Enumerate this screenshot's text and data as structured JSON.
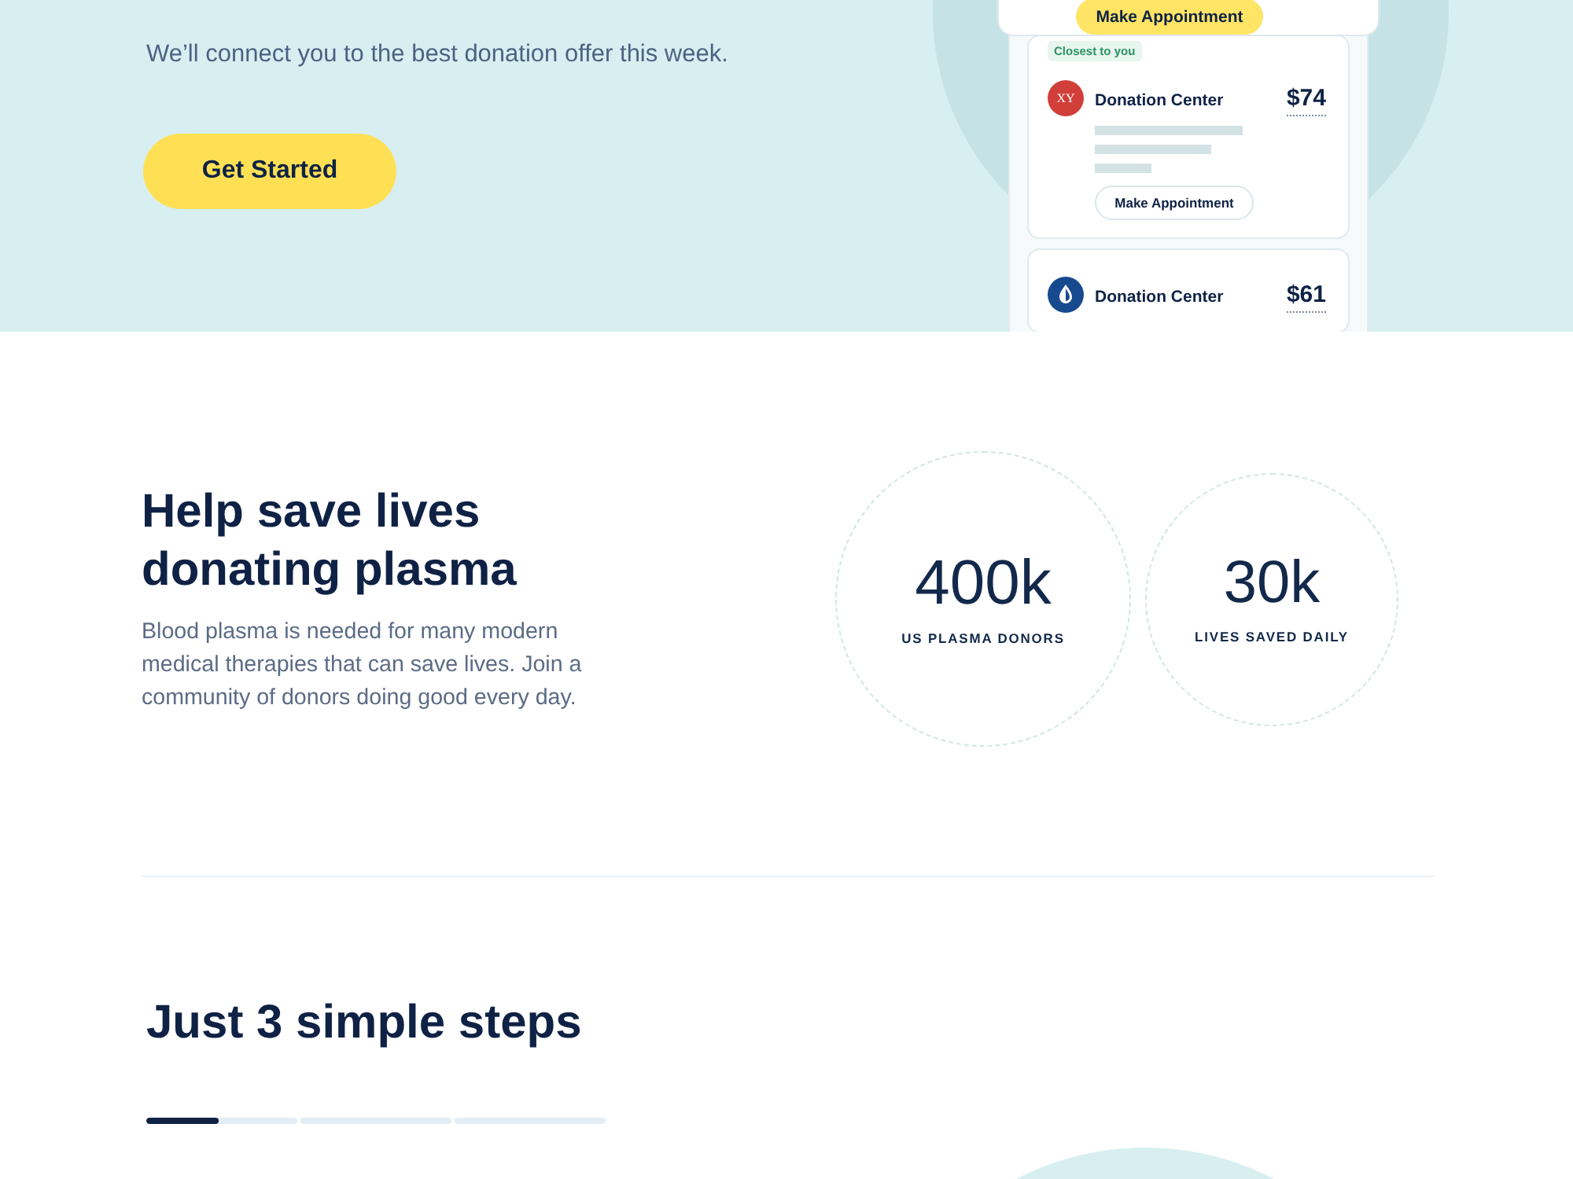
{
  "hero": {
    "subtitle": "We’ll connect you to the best donation offer this week.",
    "cta": "Get Started",
    "mockup": {
      "top_button": "Make Appointment",
      "offers": [
        {
          "kind": "initials",
          "tag": "Closest to you",
          "avatar": "XY",
          "color": "#d23f3a",
          "name": "Donation Center",
          "price": "$74",
          "button": "Make Appointment"
        },
        {
          "kind": "logo",
          "color": "#17498f",
          "name": "Donation Center",
          "price": "$61"
        }
      ]
    }
  },
  "intro": {
    "title": "Help save lives donating plasma",
    "body": "Blood plasma is needed for many modern medical therapies that can save lives. Join a community of donors doing good every day."
  },
  "stats": [
    {
      "value": "400k",
      "label": "US PLASMA DONORS"
    },
    {
      "value": "30k",
      "label": "LIVES SAVED DAILY"
    }
  ],
  "steps": {
    "title": "Just 3 simple steps",
    "indicator": [
      {
        "selected": true,
        "level": 0.48
      },
      {
        "selected": false
      },
      {
        "selected": false
      }
    ]
  }
}
